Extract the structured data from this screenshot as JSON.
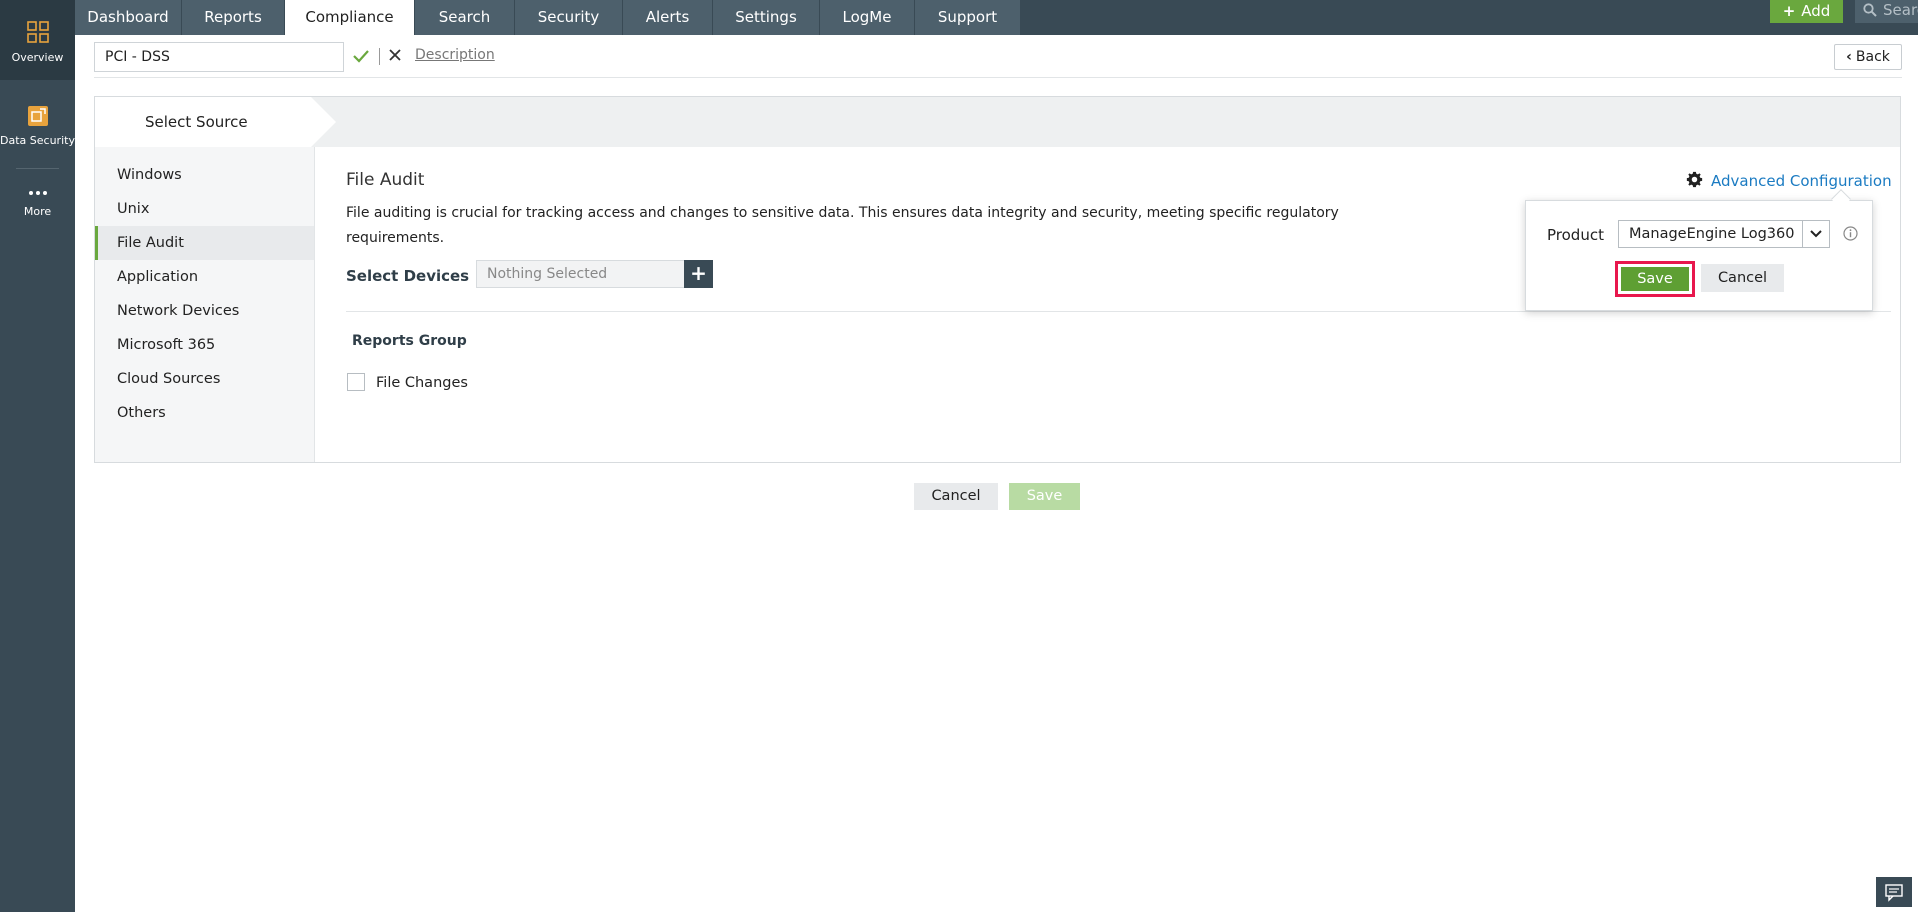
{
  "rail": {
    "items": [
      {
        "label": "Overview",
        "icon": "grid-icon"
      },
      {
        "label": "Data Security",
        "icon": "data-security-icon"
      },
      {
        "label": "More",
        "icon": "more-dots-icon"
      }
    ]
  },
  "topnav": {
    "tabs": [
      "Dashboard",
      "Reports",
      "Compliance",
      "Search",
      "Security",
      "Alerts",
      "Settings",
      "LogMe",
      "Support"
    ],
    "active_tab": "Compliance",
    "add_label": "Add",
    "search_placeholder": "Search"
  },
  "titlebar": {
    "name_value": "PCI - DSS",
    "description_link": "Description",
    "back_label": "Back"
  },
  "steps": {
    "current": "Select Source"
  },
  "sidenav": {
    "items": [
      "Windows",
      "Unix",
      "File Audit",
      "Application",
      "Network Devices",
      "Microsoft 365",
      "Cloud Sources",
      "Others"
    ],
    "active": "File Audit"
  },
  "content": {
    "title": "File Audit",
    "description": "File auditing is crucial for tracking access and changes to sensitive data. This ensures data integrity and security, meeting specific regulatory requirements.",
    "devices_label": "Select Devices",
    "devices_placeholder": "Nothing Selected",
    "reports_group_label": "Reports Group",
    "report_option": "File Changes",
    "advanced_config_label": "Advanced Configuration"
  },
  "popover": {
    "product_label": "Product",
    "product_value": "ManageEngine Log360",
    "save_label": "Save",
    "cancel_label": "Cancel"
  },
  "footer": {
    "cancel_label": "Cancel",
    "save_label": "Save"
  },
  "colors": {
    "nav_bg": "#394a55",
    "accent_green": "#6aa83e",
    "link_blue": "#1b7bc2",
    "highlight_red": "#e8174d"
  }
}
